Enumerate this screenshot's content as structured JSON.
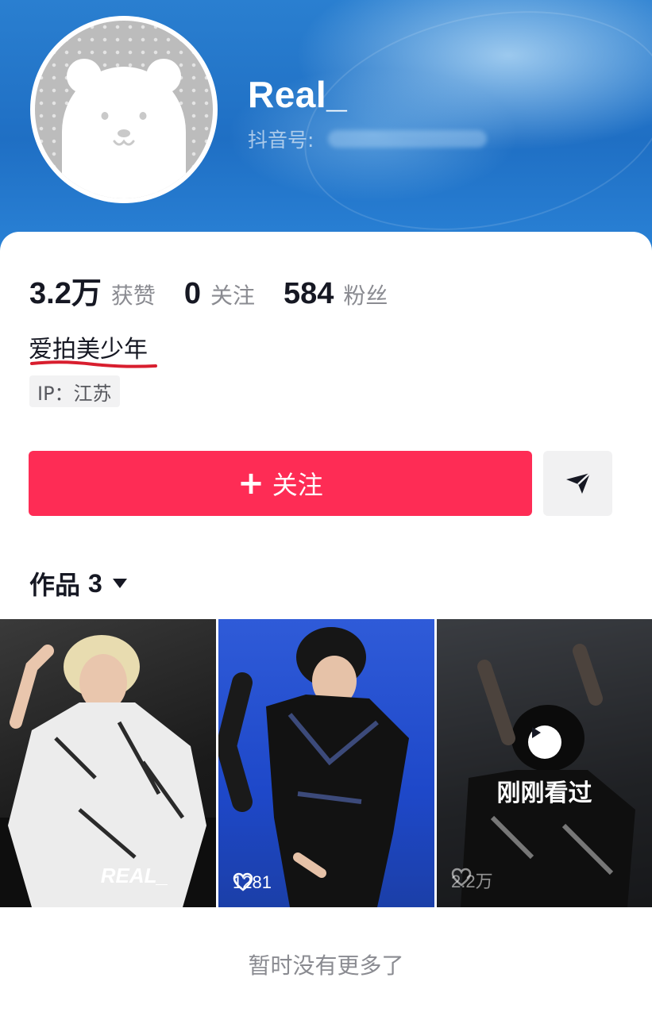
{
  "profile": {
    "username": "Real_",
    "douyin_id_label": "抖音号:",
    "bio": "爱拍美少年",
    "ip": "IP：江苏"
  },
  "stats": [
    {
      "value": "3.2万",
      "label": "获赞"
    },
    {
      "value": "0",
      "label": "关注"
    },
    {
      "value": "584",
      "label": "粉丝"
    }
  ],
  "actions": {
    "follow_label": "关注",
    "share_icon": "send-arrow-icon"
  },
  "works_tab": {
    "label": "作品",
    "count": "3"
  },
  "videos": [
    {
      "likes": "",
      "watermark": "REAL_",
      "just_watched": ""
    },
    {
      "likes": "1281",
      "watermark": "",
      "just_watched": ""
    },
    {
      "likes": "2.2万",
      "watermark": "",
      "just_watched": "刚刚看过"
    }
  ],
  "footer": {
    "no_more": "暂时没有更多了"
  },
  "colors": {
    "banner": "#1f6fc4",
    "follow_button": "#fe2c55",
    "text_primary": "#161823",
    "text_secondary": "#8a8b91"
  }
}
